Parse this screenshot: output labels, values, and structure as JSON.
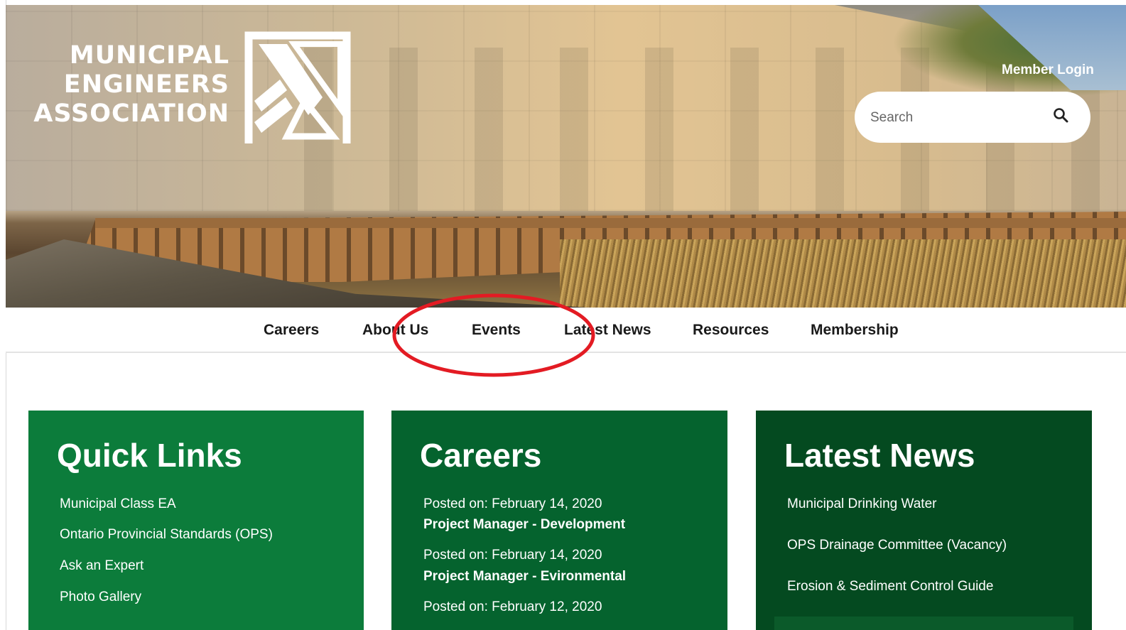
{
  "header": {
    "logo_lines": [
      "MUNICIPAL",
      "ENGINEERS",
      "ASSOCIATION"
    ],
    "logo_icon": "mea-logo-mark",
    "member_login": "Member Login",
    "search": {
      "placeholder": "Search",
      "icon": "search-icon"
    }
  },
  "nav": {
    "items": [
      "Careers",
      "About Us",
      "Events",
      "Latest News",
      "Resources",
      "Membership"
    ],
    "annotation": "red-ellipse-around-events"
  },
  "quick_links": {
    "title": "Quick Links",
    "links": [
      "Municipal Class EA",
      "Ontario Provincial Standards (OPS)",
      "Ask an Expert",
      "Photo Gallery"
    ]
  },
  "careers": {
    "title": "Careers",
    "posts": [
      {
        "posted": "Posted on: February 14, 2020",
        "title": "Project Manager - Development"
      },
      {
        "posted": "Posted on: February 14, 2020",
        "title": "Project Manager - Evironmental"
      },
      {
        "posted": "Posted on: February 12, 2020",
        "title": ""
      }
    ]
  },
  "latest_news": {
    "title": "Latest News",
    "items": [
      "Municipal Drinking Water",
      "OPS Drainage Committee (Vacancy)",
      "Erosion & Sediment Control Guide"
    ]
  },
  "colors": {
    "panel_1": "#0c7c3b",
    "panel_2": "#05632e",
    "panel_3": "#044a20",
    "annotation": "#e31b23"
  }
}
